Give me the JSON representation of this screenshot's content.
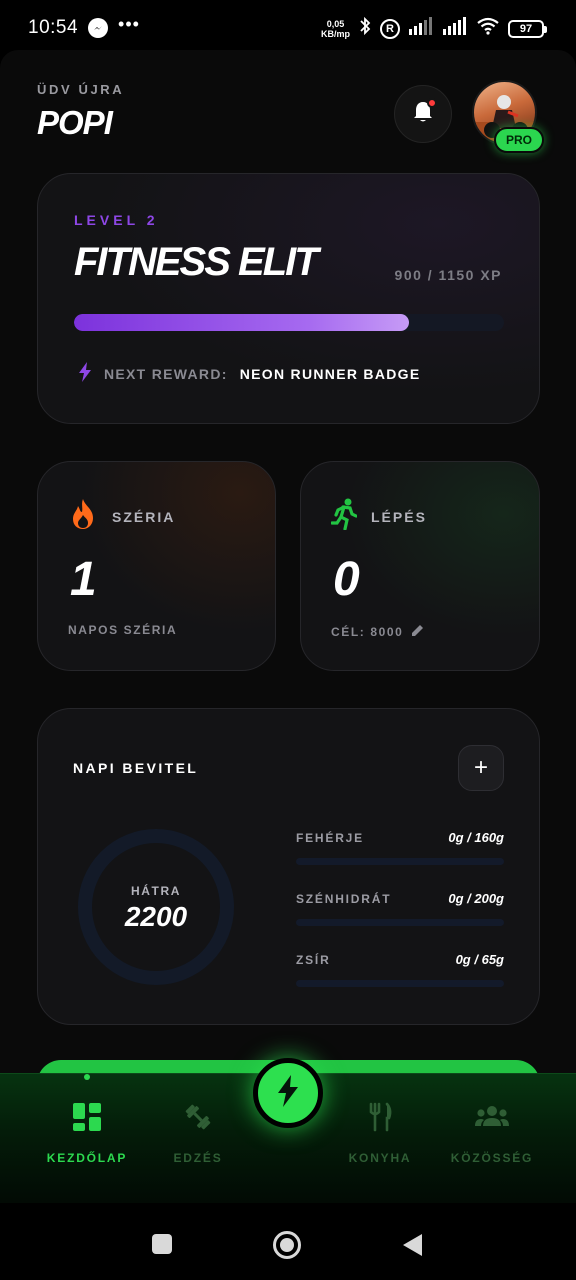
{
  "status_bar": {
    "time": "10:54",
    "dots": "•••",
    "speed_top": "0,05",
    "speed_bottom": "KB/mp",
    "registered": "R",
    "battery": "97"
  },
  "header": {
    "greeting": "ÜDV ÚJRA",
    "username": "POPI",
    "pro_badge": "PRO"
  },
  "level_card": {
    "level_label": "LEVEL 2",
    "title": "FITNESS ELIT",
    "xp_text": "900 / 1150 XP",
    "xp_progress": 0.78,
    "reward_label": "NEXT REWARD:",
    "reward_value": "NEON RUNNER BADGE"
  },
  "streak_card": {
    "title": "SZÉRIA",
    "value": "1",
    "subtitle": "NAPOS SZÉRIA"
  },
  "steps_card": {
    "title": "LÉPÉS",
    "value": "0",
    "goal": "CÉL: 8000"
  },
  "intake_card": {
    "title": "NAPI BEVITEL",
    "add_label": "+",
    "ring_label": "HÁTRA",
    "ring_value": "2200",
    "macros": [
      {
        "name": "FEHÉRJE",
        "value": "0g / 160g",
        "progress": 0
      },
      {
        "name": "SZÉNHIDRÁT",
        "value": "0g / 200g",
        "progress": 0
      },
      {
        "name": "ZSÍR",
        "value": "0g / 65g",
        "progress": 0
      }
    ]
  },
  "bottom_nav": {
    "items": [
      {
        "label": "KEZDŐLAP",
        "icon": "dashboard-icon",
        "active": true
      },
      {
        "label": "EDZÉS",
        "icon": "dumbbell-icon",
        "active": false
      },
      {
        "label": "KONYHA",
        "icon": "fork-knife-icon",
        "active": false
      },
      {
        "label": "KÖZÖSSÉG",
        "icon": "group-icon",
        "active": false
      }
    ],
    "fab_icon": "lightning-icon"
  },
  "colors": {
    "accent_green": "#2cd94f",
    "accent_purple": "#8e47e6",
    "card_bg": "#131315"
  }
}
